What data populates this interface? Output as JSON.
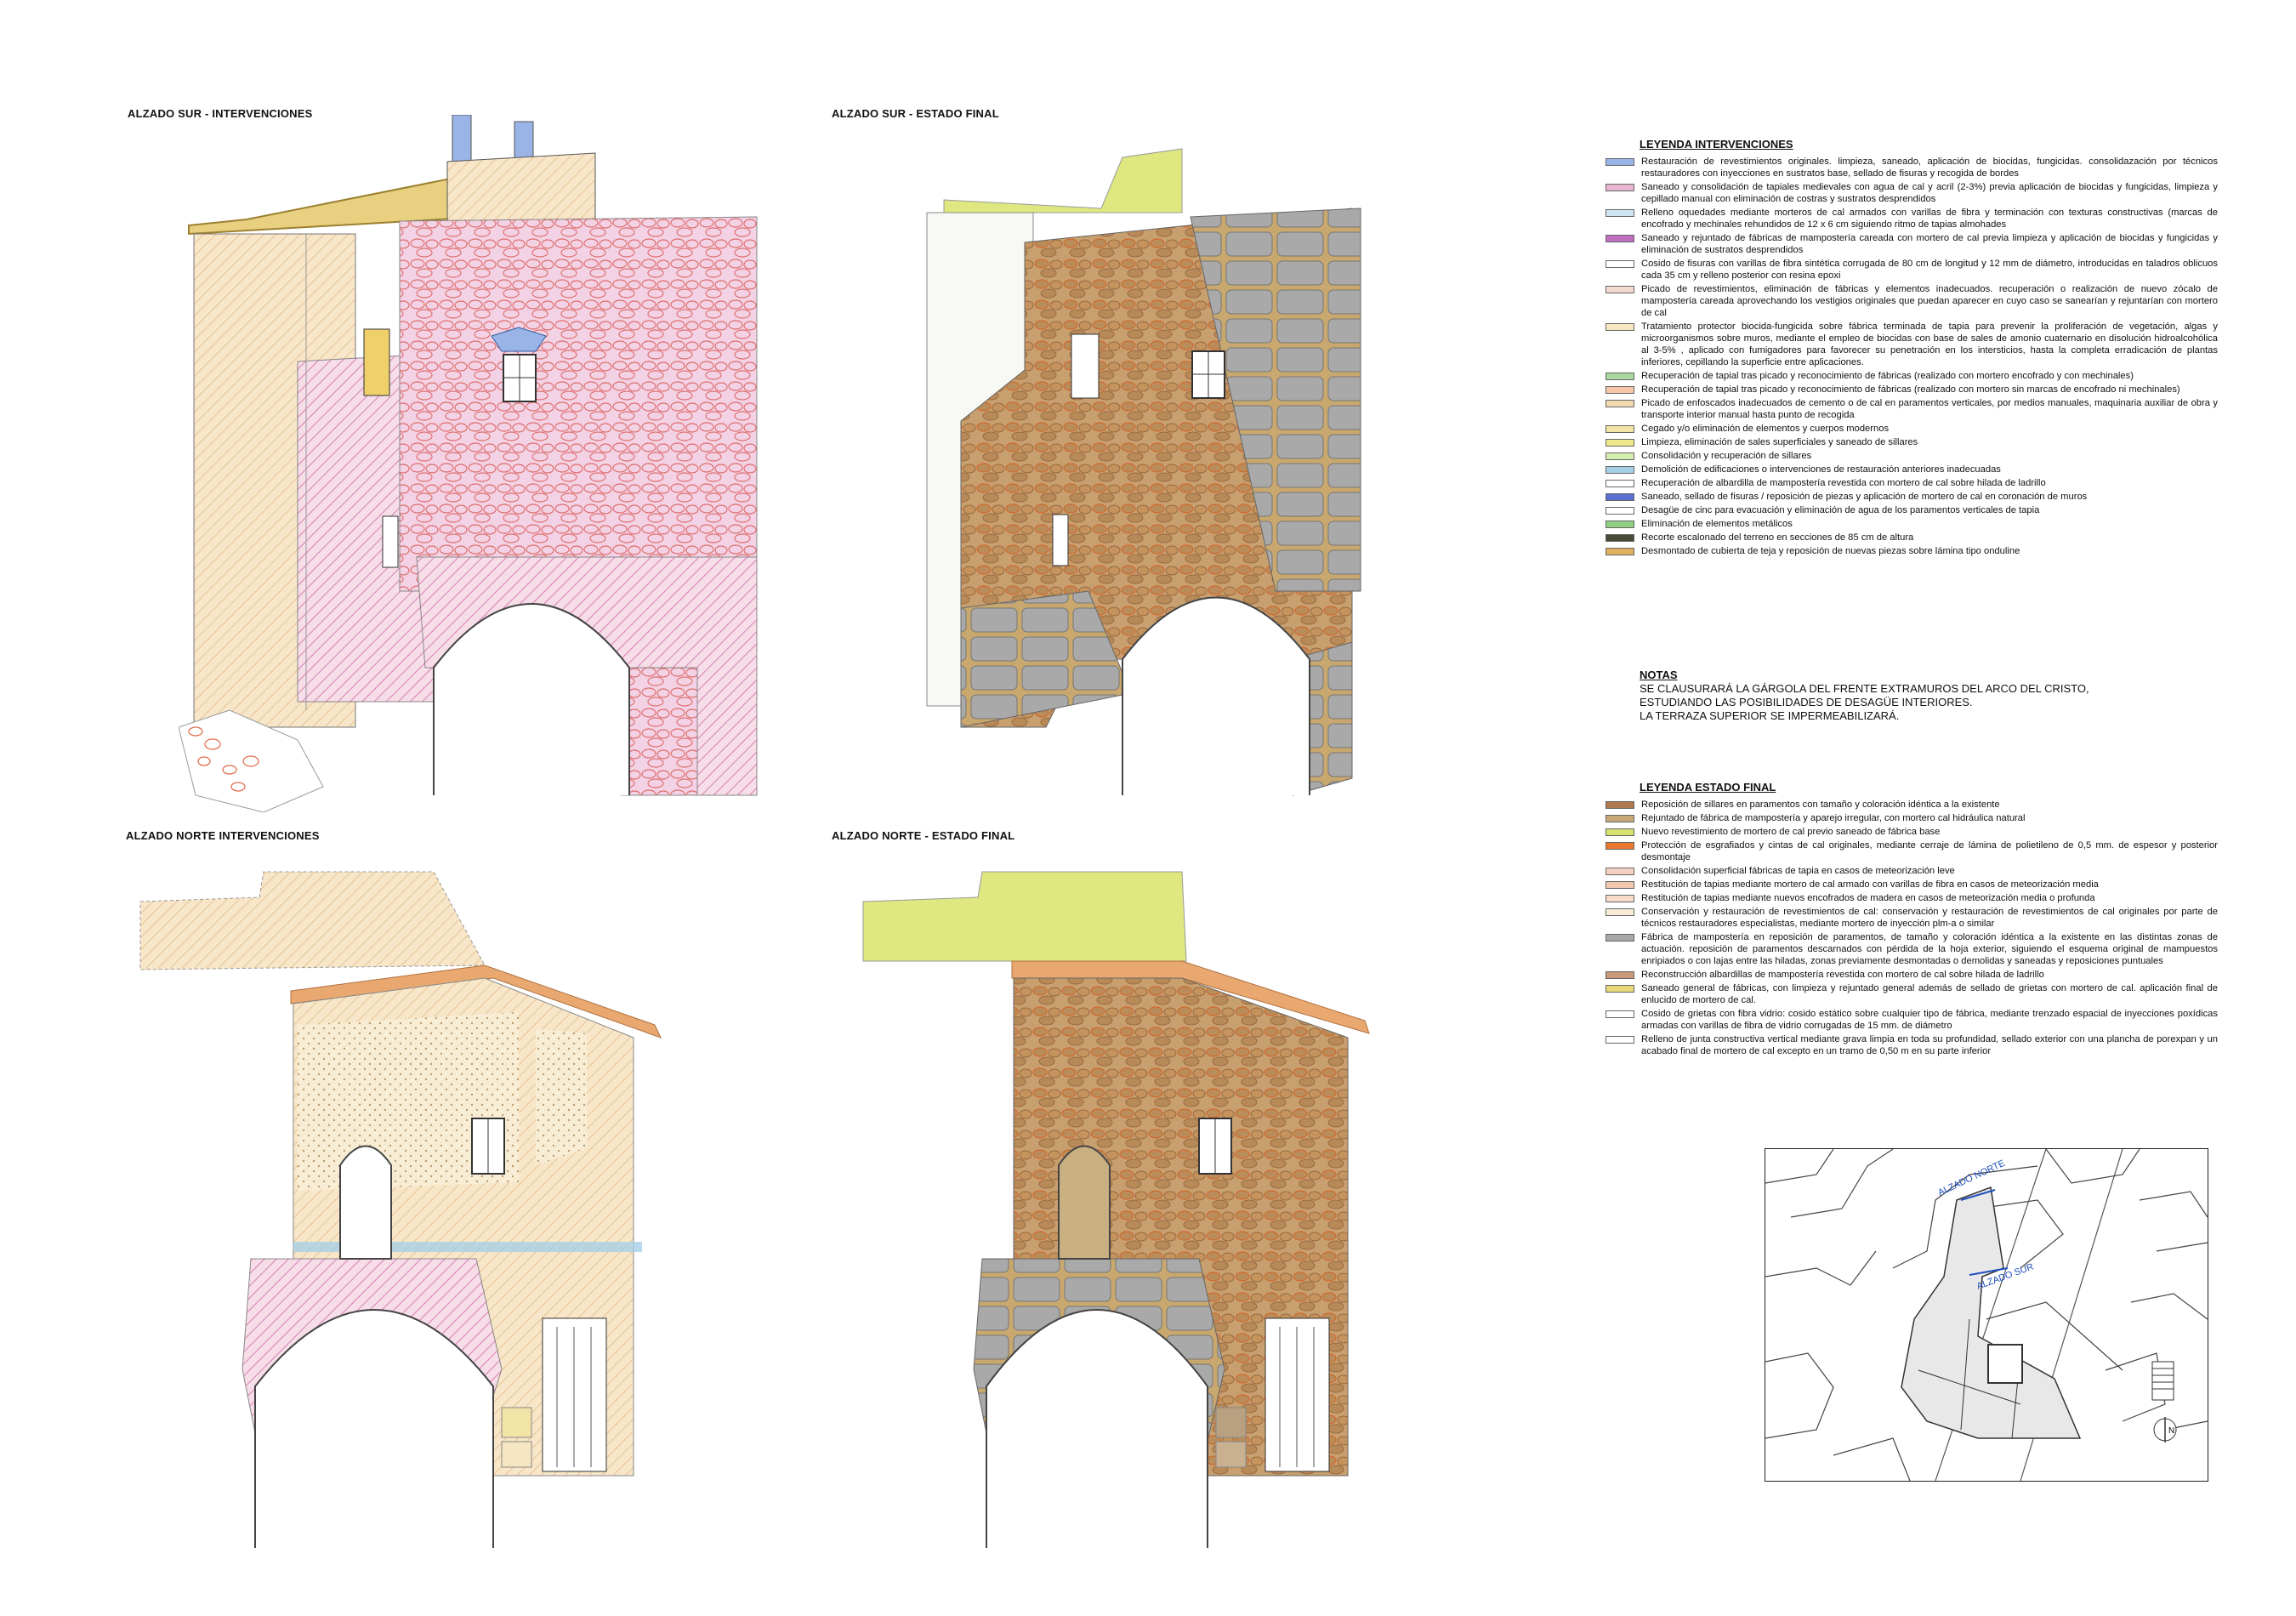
{
  "titles": {
    "south_interventions": "ALZADO SUR - INTERVENCIONES",
    "south_final": "ALZADO SUR - ESTADO FINAL",
    "north_interventions": "ALZADO NORTE  INTERVENCIONES",
    "north_final": "ALZADO NORTE - ESTADO FINAL"
  },
  "legend_interventions": {
    "title": "LEYENDA INTERVENCIONES",
    "items": [
      {
        "color": "#9ab4e8",
        "text": "Restauración de revestimientos originales. limpieza, saneado, aplicación de biocidas, fungicidas. consolidazación por técnicos restauradores con inyecciones en sustratos base, sellado de fisuras y recogida de bordes"
      },
      {
        "color": "#e8b4cf",
        "text": "Saneado y consolidación de tapiales medievales con agua de cal y acril (2-3%) previa aplicación de biocidas y fungicidas, limpieza y cepillado manual con eliminación de costras y sustratos desprendidos"
      },
      {
        "color": "#cfe6f0",
        "text": "Relleno oquedades mediante morteros de cal armados con varillas de fibra y terminación con texturas constructivas (marcas de encofrado y mechinales rehundidos de 12 x 6 cm siguiendo ritmo de tapias almohades"
      },
      {
        "color": "#c070c0",
        "text": "Saneado y rejuntado de fábricas de mampostería careada con mortero de cal previa limpieza y aplicación de biocidas y fungicidas y eliminación de sustratos desprendidos"
      },
      {
        "color": "#ffffff",
        "text": "Cosido de fisuras con varillas de fibra sintética corrugada de 80 cm de longitud y 12 mm de diámetro, introducidas en taladros oblicuos cada 35 cm y relleno posterior con resina epoxi"
      },
      {
        "color": "#f3d9d0",
        "text": "Picado de revestimientos, eliminación de fábricas y elementos inadecuados. recuperación o realización de nuevo zócalo de mampostería careada aprovechando los vestigios originales que puedan aparecer en cuyo caso se sanearían y rejuntarían con mortero de cal"
      },
      {
        "color": "#f6e7c2",
        "text": "Tratamiento protector biocida-fungicida sobre fábrica terminada de tapia para  prevenir la proliferación de vegetación, algas y microorganismos sobre muros, mediante el empleo de biocidas con base de sales de amonio cuaternario en disolución hidroalcohólica al 3-5% , aplicado con fumigadores para favorecer su penetración en los intersticios, hasta la completa erradicación de plantas inferiores, cepillando la superficie entre aplicaciones."
      },
      {
        "color": "#a8d8a0",
        "text": "Recuperación de tapial tras picado y reconocimiento de fábricas (realizado con mortero encofrado y con mechinales)"
      },
      {
        "color": "#f6c8a8",
        "text": "Recuperación de tapial tras picado y reconocimiento de fábricas (realizado con mortero sin marcas de encofrado ni mechinales)"
      },
      {
        "color": "#f0d8b0",
        "text": "Picado de enfoscados inadecuados de cemento o de cal en paramentos verticales, por medios manuales, maquinaria auxiliar de obra y transporte interior manual hasta punto de recogida"
      },
      {
        "color": "#f2e4a6",
        "text": "Cegado y/o eliminación de elementos y cuerpos modernos"
      },
      {
        "color": "#efe88a",
        "text": "Limpieza, eliminación de sales superficiales y saneado de sillares"
      },
      {
        "color": "#d4eeb0",
        "text": "Consolidación y recuperación de sillares"
      },
      {
        "color": "#a6d0e6",
        "text": "Demolición de edificaciones o intervenciones de restauración anteriores inadecuadas"
      },
      {
        "color": "#ffffff",
        "text": "Recuperación de albardilla de mampostería revestida con mortero de cal sobre hilada de ladrillo"
      },
      {
        "color": "#5a6fd0",
        "text": "Saneado, sellado de fisuras / reposición de piezas y aplicación de mortero de cal en coronación de muros"
      },
      {
        "color": "#ffffff",
        "text": "Desagüe de cinc para evacuación y eliminación de agua de los paramentos verticales de tapia"
      },
      {
        "color": "#8fd080",
        "text": "Eliminación de elementos metálicos"
      },
      {
        "color": "#4a4a38",
        "text": "Recorte escalonado del terreno en secciones de 85 cm de altura"
      },
      {
        "color": "#e0b060",
        "text": "Desmontado de cubierta de teja y reposición de nuevas piezas sobre lámina tipo onduline"
      }
    ]
  },
  "notes": {
    "title": "NOTAS",
    "lines": [
      "SE CLAUSURARÁ LA GÁRGOLA DEL FRENTE EXTRAMUROS DEL ARCO DEL CRISTO,",
      "ESTUDIANDO LAS POSIBILIDADES DE DESAGÜE INTERIORES.",
      "LA TERRAZA SUPERIOR SE IMPERMEABILIZARÁ."
    ]
  },
  "legend_final": {
    "title": "LEYENDA ESTADO FINAL",
    "items": [
      {
        "color": "#b07850",
        "text": "Reposición de sillares en paramentos  con tamaño y coloración idéntica a la existente"
      },
      {
        "color": "#c8a878",
        "text": "Rejuntado de fábrica de mampostería y aparejo irregular, con mortero cal hidráulica natural"
      },
      {
        "color": "#d8e070",
        "text": "Nuevo revestimiento de mortero de cal previo saneado de fábrica base"
      },
      {
        "color": "#e87830",
        "text": "Protección de esgrafiados y cintas de cal originales, mediante cerraje de lámina de polietileno de 0,5 mm. de espesor y posterior desmontaje"
      },
      {
        "color": "#f4d0c0",
        "text": "Consolidación superficial fábricas de tapia en casos de meteorización leve"
      },
      {
        "color": "#f0c8b0",
        "text": "Restitución de tapias mediante mortero de cal armado con varillas de fibra en casos de meteorización media"
      },
      {
        "color": "#f6dcc8",
        "text": "Restitución de tapias mediante nuevos encofrados de madera en casos de meteorización media o profunda"
      },
      {
        "color": "#f8ecd8",
        "text": "Conservación y restauración de revestimientos de cal: conservación y restauración de revestimientos de cal originales por parte de técnicos restauradores especialistas, mediante mortero de inyección plm-a o similar"
      },
      {
        "color": "#a8a8a8",
        "text": "Fábrica de mampostería en reposición de paramentos, de tamaño y coloración idéntica a la existente en las distintas zonas de actuación. reposición de paramentos descarnados con pérdida de la hoja exterior, siguiendo el esquema original de mampuestos enripiados o con lajas entre las hiladas, zonas previamente desmontadas o demolidas y saneadas y reposiciones  puntuales"
      },
      {
        "color": "#c89878",
        "text": "Reconstrucción albardillas de mampostería revestida con mortero de cal sobre hilada de ladrillo"
      },
      {
        "color": "#e8d878",
        "text": "Saneado general de fábricas, con limpieza y rejuntado general además de sellado de grietas con mortero de cal. aplicación final de enlucido de mortero de cal."
      },
      {
        "color": "#ffffff",
        "text": "Cosido de grietas con fibra vidrio: cosido estático sobre cualquier tipo de fábrica, mediante trenzado espacial de inyecciones poxídicas armadas con varillas de fibra de vidrio corrugadas de 15 mm. de diámetro"
      },
      {
        "color": "#ffffff",
        "text": "Relleno de junta constructiva vertical mediante grava limpia en toda su profundidad, sellado exterior con una plancha de porexpan y un acabado final de mortero de cal excepto en un tramo de 0,50 m en su parte inferior"
      }
    ]
  },
  "map": {
    "north_label": "ALZADO NORTE",
    "south_label": "ALZADO SUR",
    "compass": "N"
  }
}
